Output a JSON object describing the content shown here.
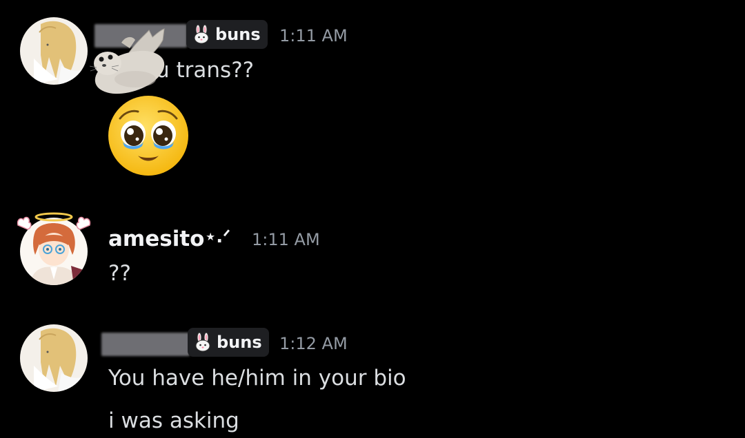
{
  "messages": [
    {
      "author_tag": "buns",
      "time": "1:11 AM",
      "lines": [
        "u trans??"
      ],
      "emoji": "pleading-face"
    },
    {
      "author": "amesito",
      "author_suffix": "⋆.ᐟ",
      "time": "1:11 AM",
      "lines": [
        "??"
      ]
    },
    {
      "author_tag": "buns",
      "time": "1:12 AM",
      "lines": [
        "You have he/him in your bio",
        "i was asking"
      ]
    }
  ],
  "icons": {
    "tag_icon": "bunny-icon",
    "decoration": "seal-sticker",
    "reaction": "pleading-face-emoji"
  },
  "colors": {
    "background": "#000000",
    "text": "#dbdee1",
    "username": "#f2f3f5",
    "timestamp": "#949ba4",
    "tag_bg": "#1e1f22"
  }
}
